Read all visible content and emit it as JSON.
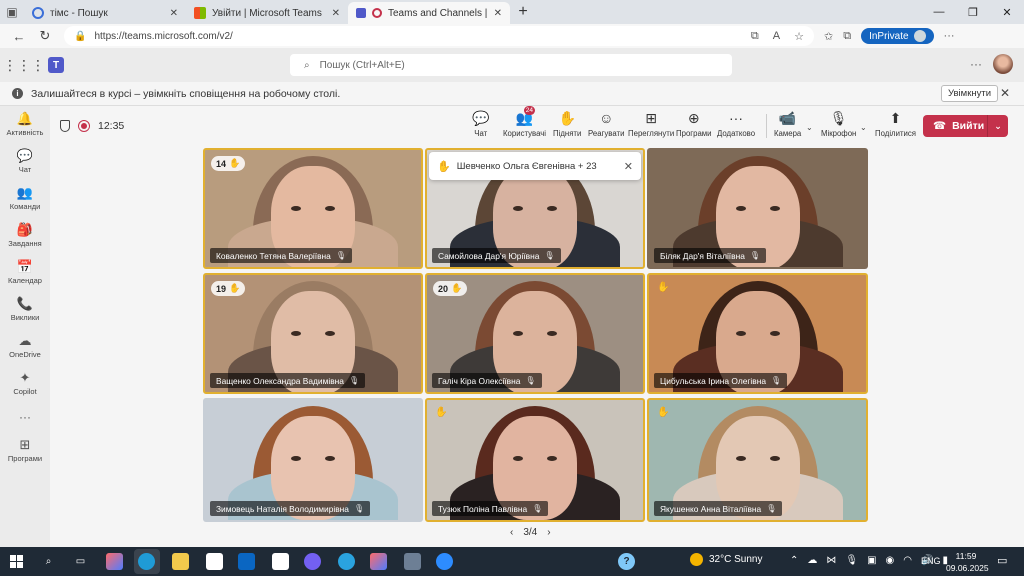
{
  "browser": {
    "tabs": [
      {
        "label": "тімс - Пошук",
        "favicon": "search-icon",
        "color": "#3b6fd8"
      },
      {
        "label": "Увійти | Microsoft Teams",
        "favicon": "microsoft-logo-icon",
        "color": "#f25022"
      },
      {
        "label": "Teams and Channels | Захисті",
        "favicon": "record-icon",
        "color": "#c4314b",
        "active": true
      }
    ],
    "url": "https://teams.microsoft.com/v2/",
    "inprivate_label": "InPrivate"
  },
  "teams": {
    "search_placeholder": "Пошук (Ctrl+Alt+E)",
    "banner_text": "Залишайтеся в курсі – увімкніть сповіщення на робочому столі.",
    "banner_button": "Увімкнути",
    "rail": [
      {
        "label": "Активність",
        "icon": "bell-icon",
        "glyph": "🔔"
      },
      {
        "label": "Чат",
        "icon": "chat-icon",
        "glyph": "💬"
      },
      {
        "label": "Команди",
        "icon": "teams-icon",
        "glyph": "👥"
      },
      {
        "label": "Завдання",
        "icon": "assignments-icon",
        "glyph": "🎒"
      },
      {
        "label": "Календар",
        "icon": "calendar-icon",
        "glyph": "📅"
      },
      {
        "label": "Виклики",
        "icon": "phone-icon",
        "glyph": "📞"
      },
      {
        "label": "OneDrive",
        "icon": "cloud-icon",
        "glyph": "☁"
      },
      {
        "label": "Copilot",
        "icon": "copilot-icon",
        "glyph": "✦"
      }
    ],
    "rail_apps_label": "Програми"
  },
  "meeting": {
    "time": "12:35",
    "toolbar": [
      {
        "label": "Чат",
        "icon": "chat-icon",
        "glyph": "💬"
      },
      {
        "label": "Користувачі",
        "icon": "people-icon",
        "glyph": "👥",
        "badge": "24"
      },
      {
        "label": "Підняти",
        "icon": "raise-hand-icon",
        "glyph": "✋"
      },
      {
        "label": "Реагувати",
        "icon": "smiley-icon",
        "glyph": "☺"
      },
      {
        "label": "Переглянути",
        "icon": "view-icon",
        "glyph": "⊞"
      },
      {
        "label": "Програми",
        "icon": "apps-icon",
        "glyph": "⊕"
      },
      {
        "label": "Додатково",
        "icon": "more-icon",
        "glyph": "···"
      },
      {
        "label": "Камера",
        "icon": "camera-icon",
        "glyph": "📹"
      },
      {
        "label": "Мікрофон",
        "icon": "microphone-icon",
        "glyph": "🎙"
      },
      {
        "label": "Поділитися",
        "icon": "share-icon",
        "glyph": "⬆"
      }
    ],
    "leave_label": "Вийти",
    "raised_hands_queue": "Шевченко Ольга Євгенівна + 23",
    "pager": "3/4",
    "tiles": [
      {
        "name": "Коваленко Тетяна Валеріївна",
        "hand_order": "14",
        "bg": "#b89c7e",
        "skin": "#e4b9a0",
        "hair": "#8a6a55",
        "shirt": "#c9a88f",
        "highlight": true
      },
      {
        "name": "Самойлова Дар'я Юріївна",
        "hand_order": "",
        "bg": "#d9d6d2",
        "skin": "#d7b2a0",
        "hair": "#5c4636",
        "shirt": "#2b2f38",
        "highlight": true
      },
      {
        "name": "Біляк Дар'я Віталіївна",
        "hand_order": "",
        "bg": "#7e6a57",
        "skin": "#e2b8a2",
        "hair": "#6b3f2a",
        "shirt": "#4d3a2e",
        "highlight": false
      },
      {
        "name": "Ващенко Олександра Вадимівна",
        "hand_order": "19",
        "bg": "#b39276",
        "skin": "#e0bca6",
        "hair": "#9a7c63",
        "shirt": "#6a5447",
        "highlight": true
      },
      {
        "name": "Галіч Кіра Олексіївна",
        "hand_order": "20",
        "bg": "#9d8f82",
        "skin": "#dcb39c",
        "hair": "#7b4a33",
        "shirt": "#3e3a38",
        "highlight": true
      },
      {
        "name": "Цибульська Ірина Олегівна",
        "hand_order": "",
        "bg": "#c88a55",
        "skin": "#d9a98d",
        "hair": "#3d2418",
        "shirt": "#5a2e22",
        "highlight": true,
        "hand_only": true
      },
      {
        "name": "Зимовець Наталія Володимирівна",
        "hand_order": "",
        "bg": "#c7ced6",
        "skin": "#e8c3b0",
        "hair": "#9b5a34",
        "shirt": "#a9c4cf",
        "highlight": false
      },
      {
        "name": "Тузюк Поліна Павлівна",
        "hand_order": "",
        "bg": "#c9c3ba",
        "skin": "#e1b4a0",
        "hair": "#5a2a1e",
        "shirt": "#2a2222",
        "highlight": true,
        "hand_only": true
      },
      {
        "name": "Якушенко Анна Віталіївна",
        "hand_order": "",
        "bg": "#9fb7b0",
        "skin": "#e3c8b4",
        "hair": "#b38b62",
        "shirt": "#d8c9bd",
        "highlight": true,
        "hand_only": true
      }
    ]
  },
  "taskbar": {
    "weather": "32°C  Sunny",
    "lang": "ENG",
    "time": "11:59",
    "date": "09.06.2025"
  }
}
